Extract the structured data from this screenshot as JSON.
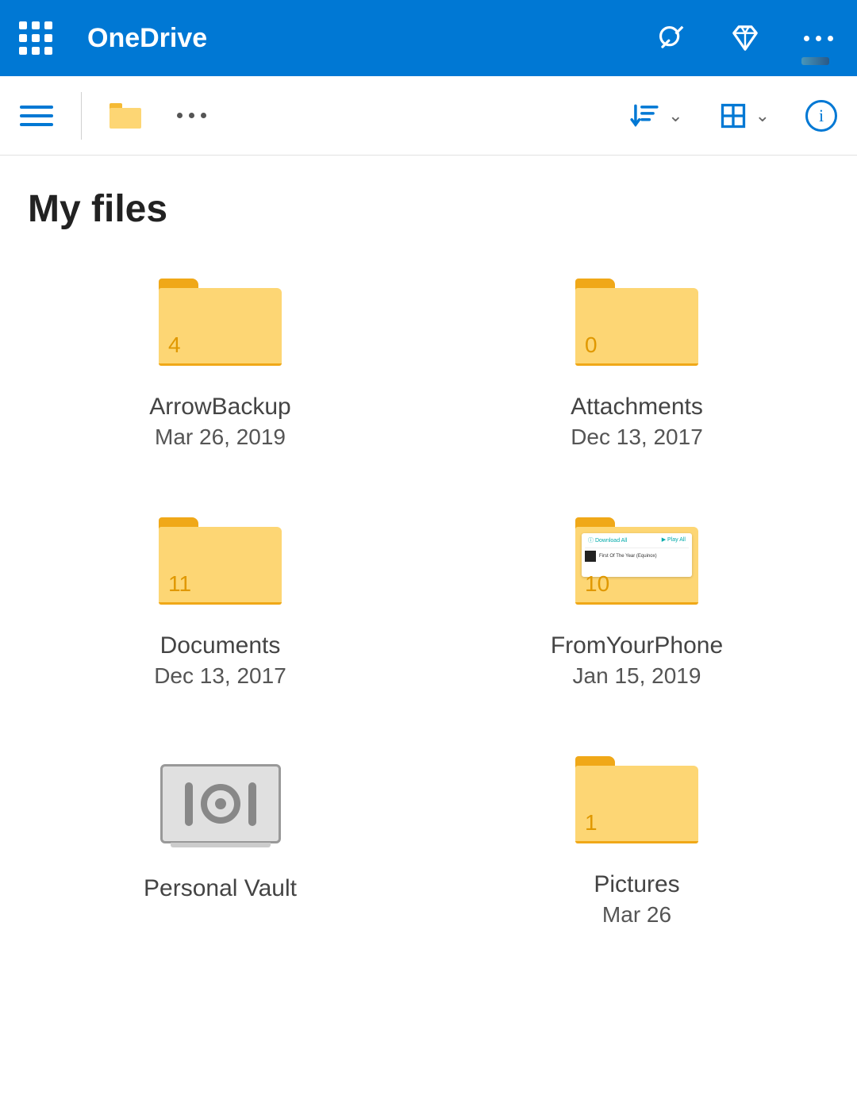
{
  "header": {
    "title": "OneDrive"
  },
  "page": {
    "title": "My files"
  },
  "files": [
    {
      "name": "ArrowBackup",
      "date": "Mar 26, 2019",
      "count": "4",
      "type": "folder"
    },
    {
      "name": "Attachments",
      "date": "Dec 13, 2017",
      "count": "0",
      "type": "folder"
    },
    {
      "name": "Documents",
      "date": "Dec 13, 2017",
      "count": "11",
      "type": "folder"
    },
    {
      "name": "FromYourPhone",
      "date": "Jan 15, 2019",
      "count": "10",
      "type": "folder-preview"
    },
    {
      "name": "Personal Vault",
      "date": "",
      "count": "",
      "type": "vault"
    },
    {
      "name": "Pictures",
      "date": "Mar 26",
      "count": "1",
      "type": "folder"
    }
  ],
  "preview_labels": {
    "left": "Download All",
    "right": "Play All",
    "caption": "First Of The Year (Equinox)"
  }
}
